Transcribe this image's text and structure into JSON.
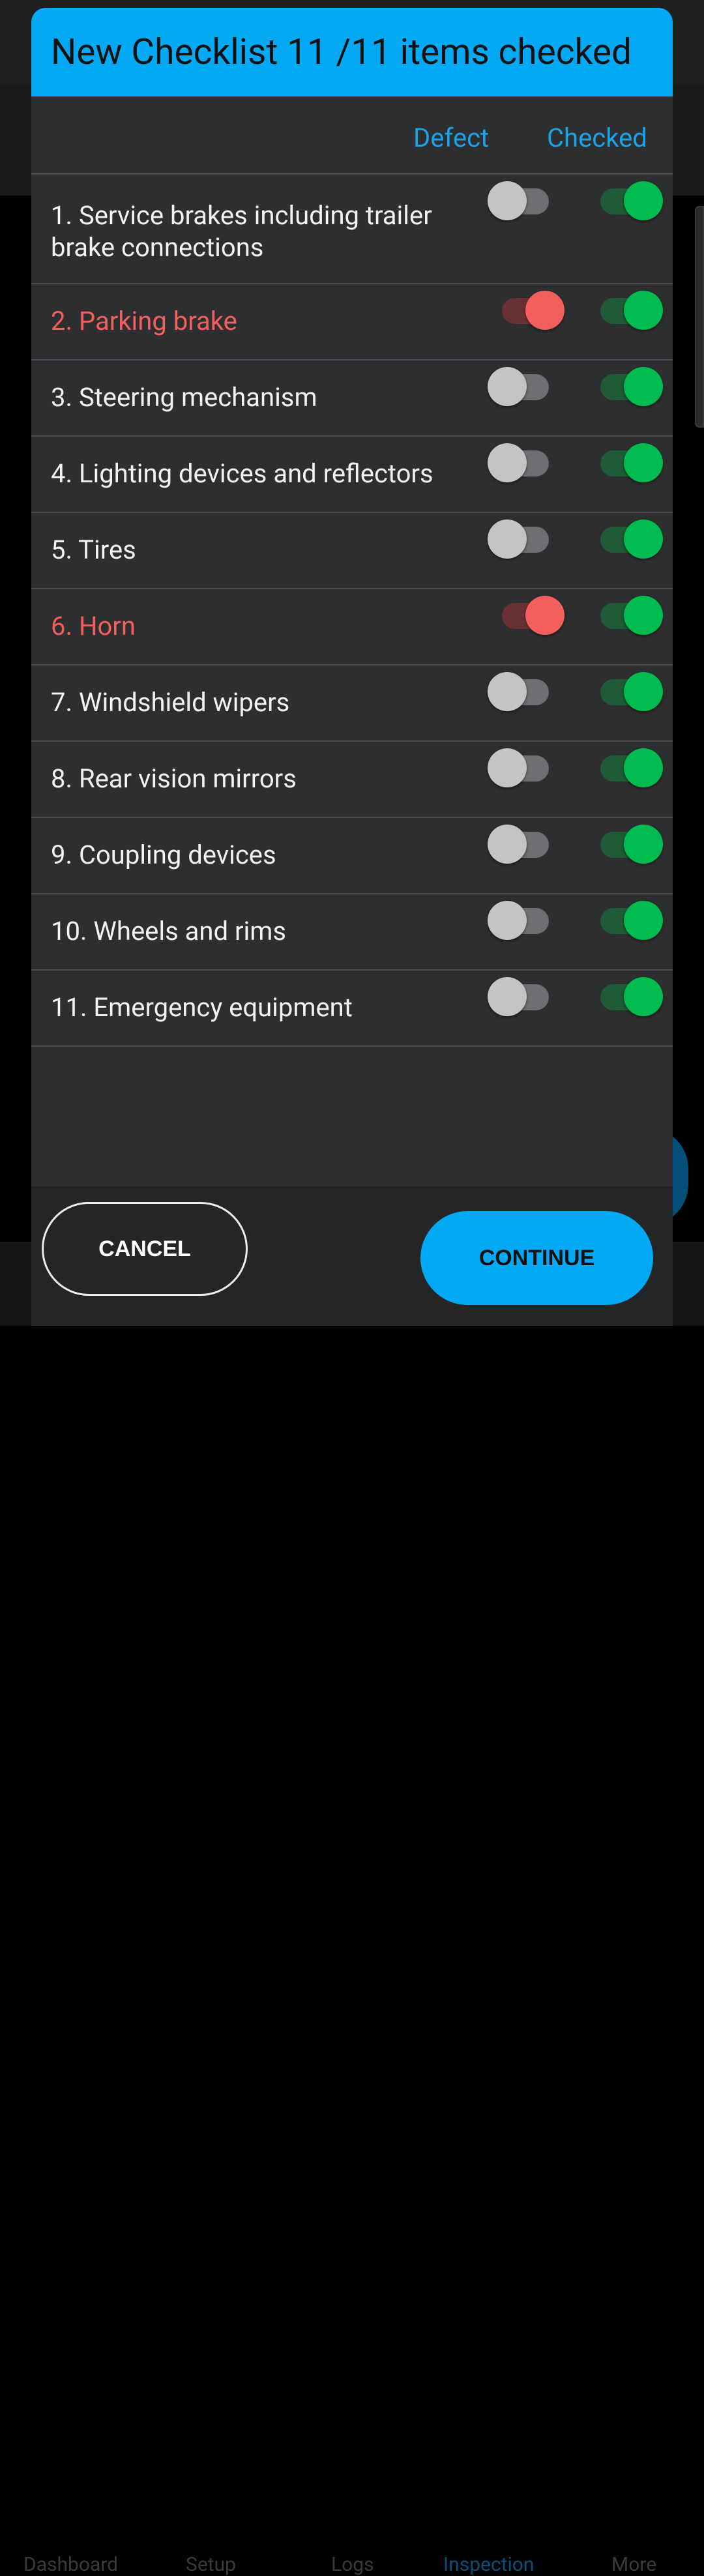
{
  "background_nav": {
    "items": [
      {
        "label": "Dashboard"
      },
      {
        "label": "Setup"
      },
      {
        "label": "Logs"
      },
      {
        "label": "Inspection"
      },
      {
        "label": "More"
      }
    ]
  },
  "dialog": {
    "title": "New Checklist 11 /11 items checked",
    "columns": {
      "defect": "Defect",
      "checked": "Checked"
    },
    "items": [
      {
        "label": "1. Service brakes including trailer brake connections",
        "defect": false,
        "checked": true
      },
      {
        "label": "2. Parking brake",
        "defect": true,
        "checked": true
      },
      {
        "label": "3. Steering mechanism",
        "defect": false,
        "checked": true
      },
      {
        "label": "4. Lighting devices and reflectors",
        "defect": false,
        "checked": true
      },
      {
        "label": "5. Tires",
        "defect": false,
        "checked": true
      },
      {
        "label": "6. Horn",
        "defect": true,
        "checked": true
      },
      {
        "label": "7. Windshield wipers",
        "defect": false,
        "checked": true
      },
      {
        "label": "8. Rear vision mirrors",
        "defect": false,
        "checked": true
      },
      {
        "label": "9. Coupling devices",
        "defect": false,
        "checked": true
      },
      {
        "label": "10. Wheels and rims",
        "defect": false,
        "checked": true
      },
      {
        "label": "11. Emergency equipment",
        "defect": false,
        "checked": true
      }
    ],
    "buttons": {
      "cancel": "CANCEL",
      "continue": "CONTINUE"
    }
  },
  "colors": {
    "accent": "#03a9f4",
    "checked_on": "#00bb4d",
    "defect_on": "#f25f5c",
    "dialog_bg": "#2d2e30"
  }
}
